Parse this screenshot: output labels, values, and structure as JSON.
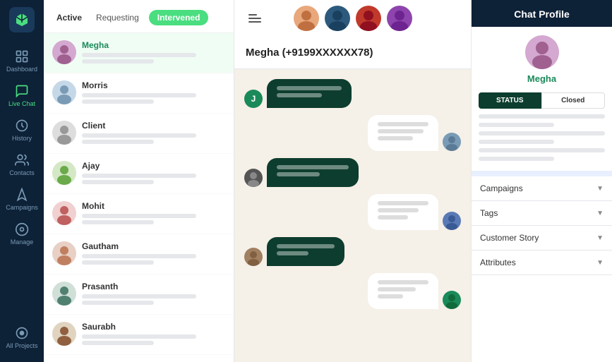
{
  "sidebar": {
    "logo_label": "logo",
    "items": [
      {
        "label": "Dashboard",
        "icon": "grid"
      },
      {
        "label": "Live Chat",
        "icon": "chat",
        "active": true
      },
      {
        "label": "History",
        "icon": "clock"
      },
      {
        "label": "Contacts",
        "icon": "contacts"
      },
      {
        "label": "Campaigns",
        "icon": "campaigns"
      },
      {
        "label": "Manage",
        "icon": "settings"
      },
      {
        "label": "All Projects",
        "icon": "circle"
      }
    ]
  },
  "tabs": {
    "active": "Active",
    "requesting": "Requesting",
    "intervened": "Intervened"
  },
  "chat_list": [
    {
      "name": "Megha",
      "selected": true,
      "highlight": true
    },
    {
      "name": "Morris",
      "selected": false,
      "highlight": false
    },
    {
      "name": "Client",
      "selected": false,
      "highlight": false
    },
    {
      "name": "Ajay",
      "selected": false,
      "highlight": false
    },
    {
      "name": "Mohit",
      "selected": false,
      "highlight": false
    },
    {
      "name": "Gautham",
      "selected": false,
      "highlight": false
    },
    {
      "name": "Prasanth",
      "selected": false,
      "highlight": false
    },
    {
      "name": "Saurabh",
      "selected": false,
      "highlight": false
    }
  ],
  "chat_header": {
    "title": "Megha (+9199XXXXXX78)"
  },
  "profile": {
    "header": "Chat Profile",
    "name": "Megha",
    "status_label": "STATUS",
    "status_value": "Closed",
    "accordion_items": [
      {
        "label": "Campaigns"
      },
      {
        "label": "Tags"
      },
      {
        "label": "Customer Story"
      },
      {
        "label": "Attributes"
      }
    ]
  },
  "top_agents": [
    {
      "color": "#e8a87c"
    },
    {
      "color": "#2d5a7c"
    },
    {
      "color": "#c0392b"
    },
    {
      "color": "#8e44ad"
    }
  ]
}
